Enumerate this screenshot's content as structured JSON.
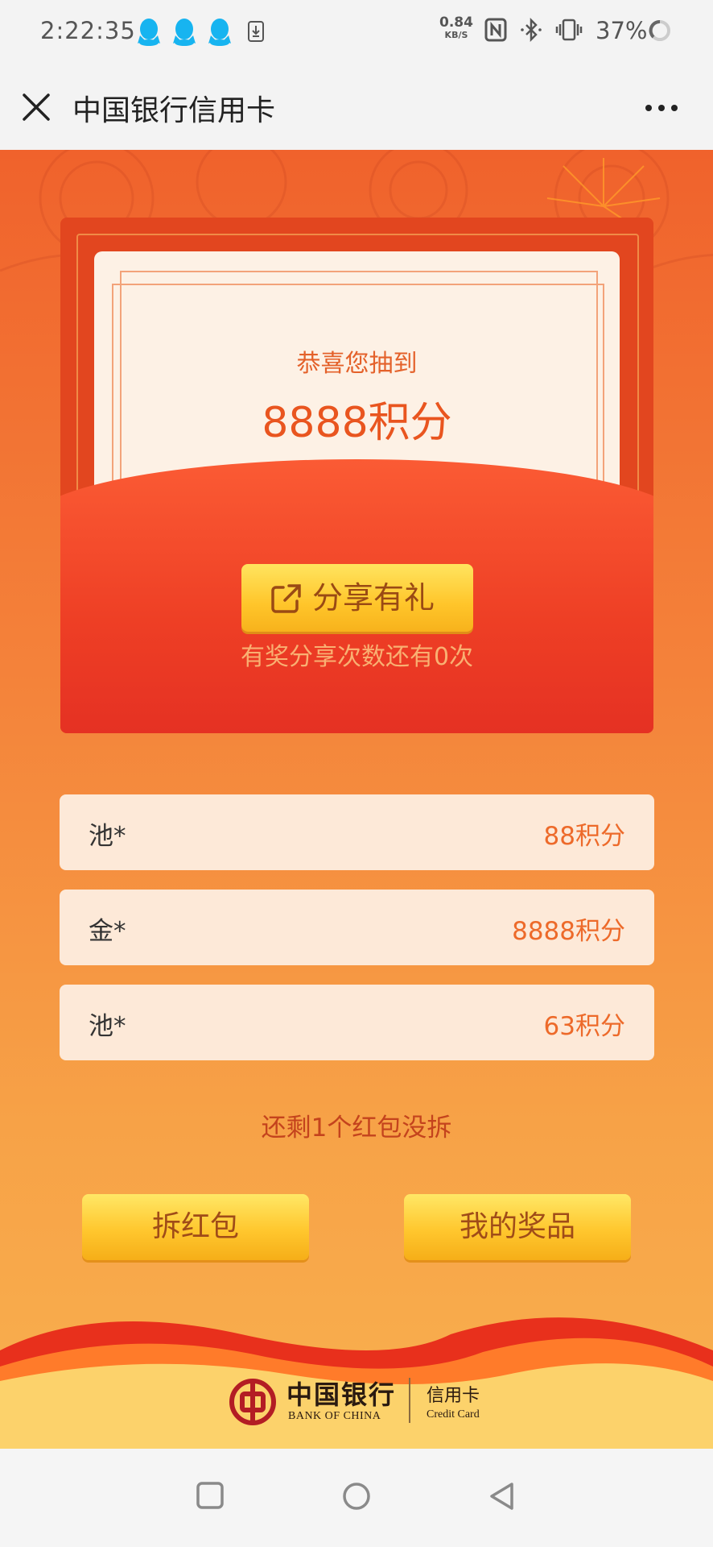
{
  "status_bar": {
    "time": "2:22:35",
    "net_speed": "0.84",
    "net_unit": "KB/S",
    "battery": "37%"
  },
  "title_bar": {
    "title": "中国银行信用卡"
  },
  "envelope": {
    "congrats": "恭喜您抽到",
    "prize": "8888积分",
    "share_button": "分享有礼",
    "share_note": "有奖分享次数还有0次"
  },
  "records": [
    {
      "name": "池*",
      "points": "88积分"
    },
    {
      "name": "金*",
      "points": "8888积分"
    },
    {
      "name": "池*",
      "points": "63积分"
    }
  ],
  "remaining_text": "还剩1个红包没拆",
  "buttons": {
    "open": "拆红包",
    "my_prizes": "我的奖品"
  },
  "footer_logo": {
    "bank_cn": "中国银行",
    "bank_en": "BANK OF CHINA",
    "card_cn": "信用卡",
    "card_en": "Credit Card"
  },
  "colors": {
    "accent_orange": "#e9551f",
    "envelope_red": "#e2461f",
    "button_yellow": "#ffc52a",
    "bank_red": "#b31d24"
  }
}
